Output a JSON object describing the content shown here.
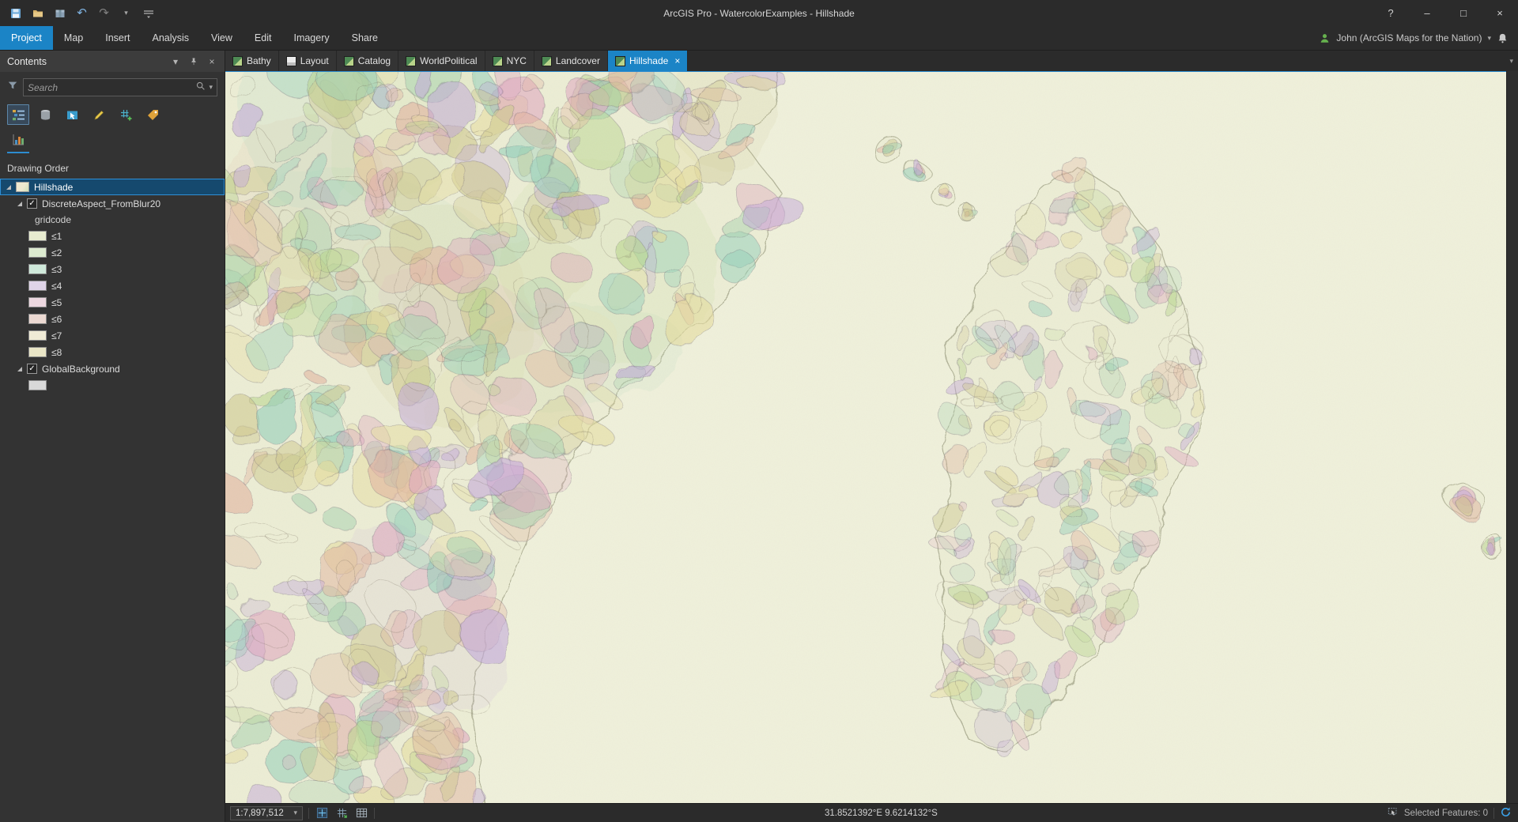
{
  "icons": {
    "check": "✓",
    "chevron_down": "▾",
    "undo": "↶",
    "redo": "↷",
    "help": "?",
    "minimize": "–",
    "maximize": "□",
    "close": "×"
  },
  "titlebar": {
    "title": "ArcGIS Pro - WatercolorExamples - Hillshade"
  },
  "ribbon": {
    "tabs": [
      "Project",
      "Map",
      "Insert",
      "Analysis",
      "View",
      "Edit",
      "Imagery",
      "Share"
    ],
    "account_label": "John (ArcGIS Maps for the Nation)"
  },
  "view_tabs": {
    "tabs": [
      "Bathy",
      "Layout",
      "Catalog",
      "WorldPolitical",
      "NYC",
      "Landcover",
      "Hillshade"
    ]
  },
  "contents": {
    "title": "Contents",
    "search_placeholder": "Search",
    "drawing_order_label": "Drawing Order",
    "hillshade_layer": "Hillshade",
    "discrete_layer": "DiscreteAspect_FromBlur20",
    "field_label": "gridcode",
    "classes": [
      {
        "label": "≤1",
        "color": "#e8ecd0"
      },
      {
        "label": "≤2",
        "color": "#dceacf"
      },
      {
        "label": "≤3",
        "color": "#cfe9da"
      },
      {
        "label": "≤4",
        "color": "#dfd4e8"
      },
      {
        "label": "≤5",
        "color": "#edd8e0"
      },
      {
        "label": "≤6",
        "color": "#ecd9d2"
      },
      {
        "label": "≤7",
        "color": "#f0ebd6"
      },
      {
        "label": "≤8",
        "color": "#e9e5c6"
      }
    ],
    "background_layer": "GlobalBackground",
    "background_swatch_color": "#d9d9d9"
  },
  "statusbar": {
    "scale": "1:7,897,512",
    "coordinates": "31.8521392°E 9.6214132°S",
    "selected_features": "Selected Features: 0"
  },
  "map": {
    "ocean": "#f0f1dc",
    "land": "#edeed6",
    "palette": [
      "#b9d68f",
      "#a9d4b2",
      "#92d0bb",
      "#c3a8dc",
      "#e0a8c2",
      "#e2b3a0",
      "#e6dd9d",
      "#cfc98f"
    ]
  }
}
